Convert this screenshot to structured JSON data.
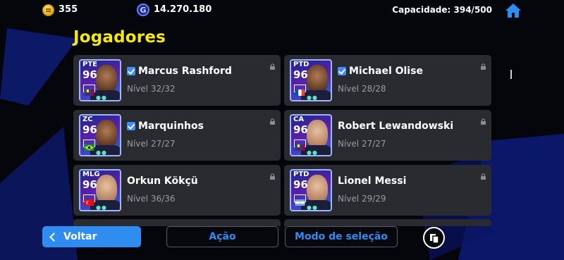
{
  "topbar": {
    "coins": "355",
    "gp": "14.270.180",
    "gp_icon_letter": "G",
    "capacity": "Capacidade: 394/500"
  },
  "title": "Jogadores",
  "players": [
    {
      "position": "PTE",
      "rating": "96",
      "name": "Marcus Rashford",
      "level": "Nível 32/32",
      "verified": true,
      "flag": "barcelona"
    },
    {
      "position": "PTD",
      "rating": "96",
      "name": "Michael Olise",
      "level": "Nível 28/28",
      "verified": true,
      "flag": "france"
    },
    {
      "position": "ZC",
      "rating": "96",
      "name": "Marquinhos",
      "level": "Nível 27/27",
      "verified": true,
      "flag": "brazil"
    },
    {
      "position": "CA",
      "rating": "96",
      "name": "Robert Lewandowski",
      "level": "Nível 27/27",
      "verified": false,
      "flag": "barcelona"
    },
    {
      "position": "MLG",
      "rating": "96",
      "name": "Orkun Kökçü",
      "level": "Nível 36/36",
      "verified": false,
      "flag": "turkey"
    },
    {
      "position": "PTD",
      "rating": "96",
      "name": "Lionel Messi",
      "level": "Nível 29/29",
      "verified": false,
      "flag": "argentina"
    }
  ],
  "buttons": {
    "back": "Voltar",
    "action": "Ação",
    "selection_mode": "Modo de seleção"
  },
  "colors": {
    "accent": "#2f8cf0",
    "title": "#f3e812",
    "card": "#2a2b30"
  }
}
